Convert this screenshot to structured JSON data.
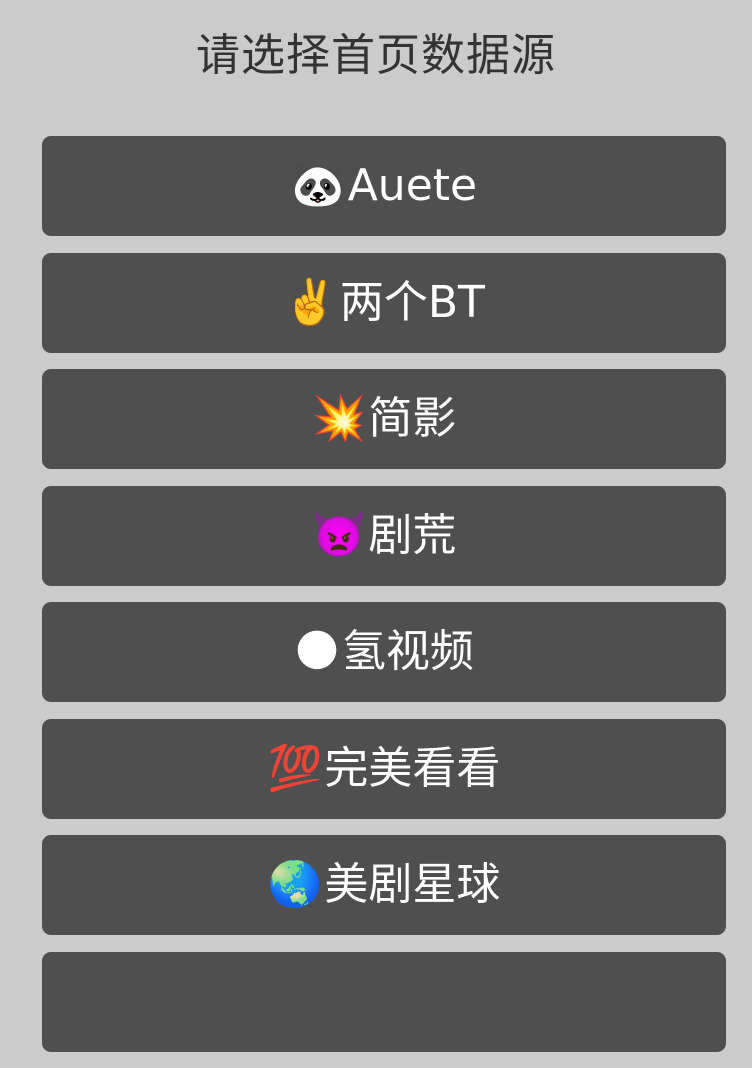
{
  "dialog": {
    "title": "请选择首页数据源"
  },
  "sources": [
    {
      "icon": "🐼",
      "icon_name": "panda-icon",
      "label": "Auete"
    },
    {
      "icon": "✌️",
      "icon_name": "victory-hand-icon",
      "label": "两个BT"
    },
    {
      "icon": "💥",
      "icon_name": "collision-icon",
      "label": "简影"
    },
    {
      "icon": "👿",
      "icon_name": "angry-devil-icon",
      "label": "剧荒"
    },
    {
      "icon": "🌑",
      "icon_name": "dark-circle-icon",
      "label": "氢视频"
    },
    {
      "icon": "💯",
      "icon_name": "hundred-points-icon",
      "label": "完美看看"
    },
    {
      "icon": "🌏",
      "icon_name": "globe-icon",
      "label": "美剧星球"
    }
  ]
}
